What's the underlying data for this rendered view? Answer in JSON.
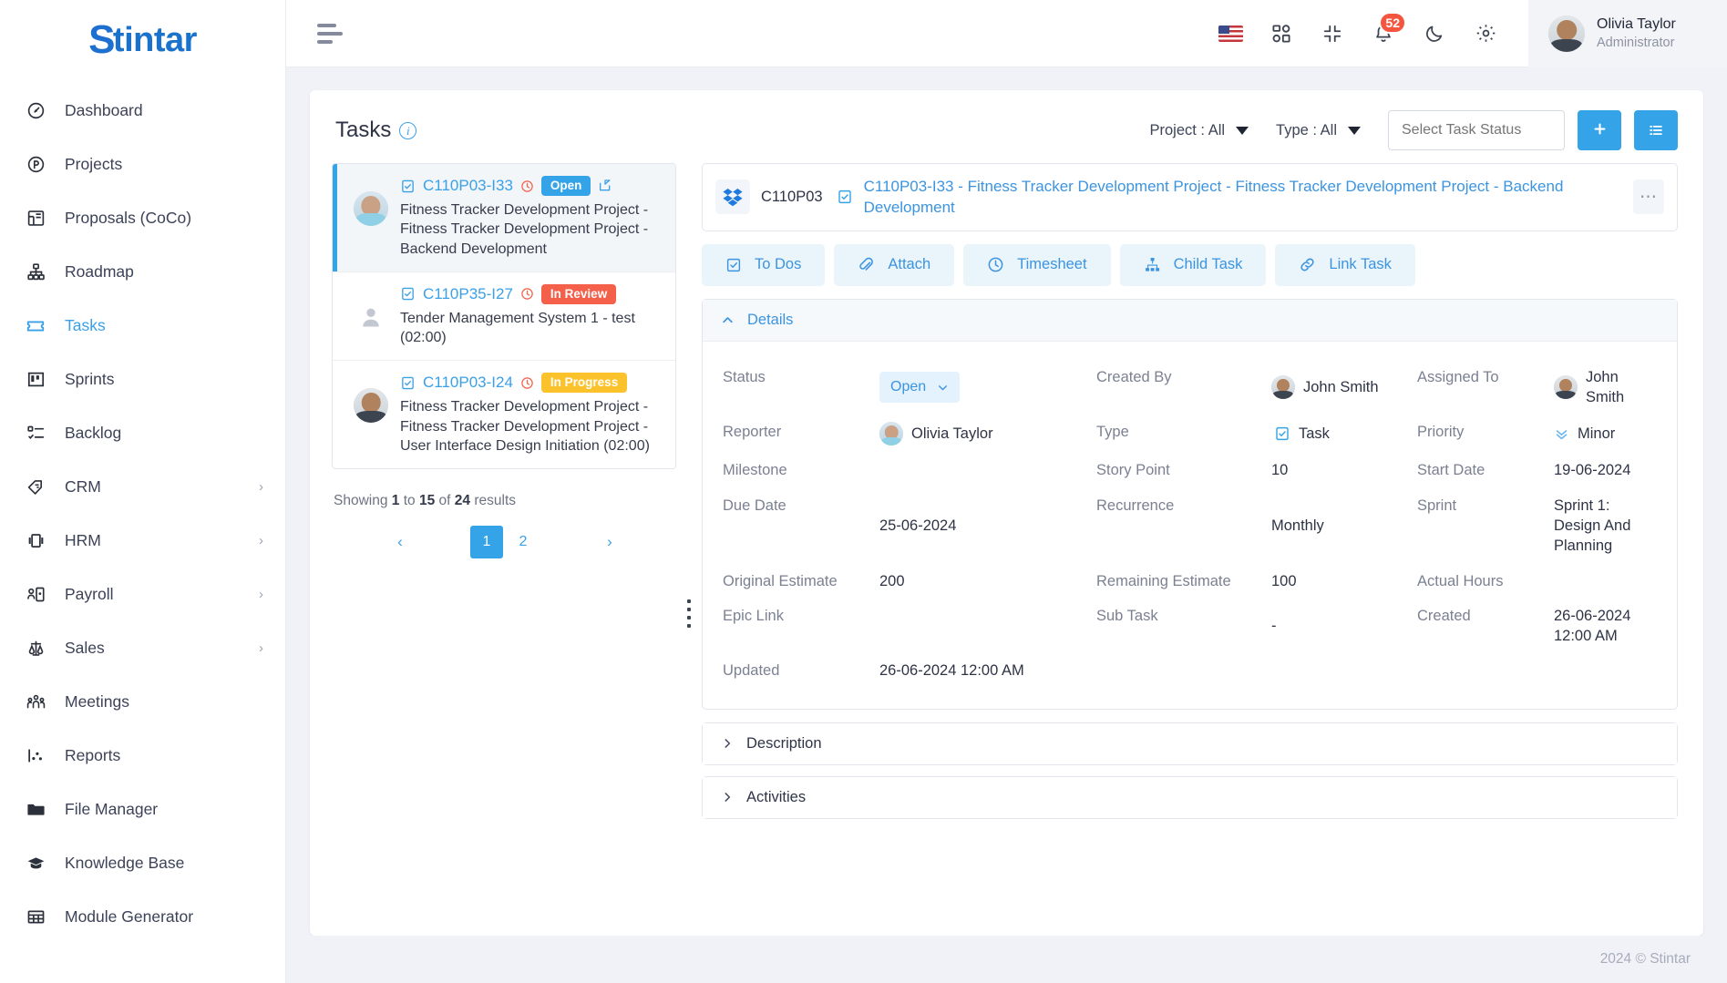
{
  "brand": {
    "logo_first": "S",
    "logo_rest": "tintar",
    "accent": "#34a3e8"
  },
  "sidebar": {
    "items": [
      {
        "label": "Dashboard",
        "icon": "gauge-icon",
        "active": false,
        "expandable": false
      },
      {
        "label": "Projects",
        "icon": "circle-p-icon",
        "active": false,
        "expandable": false
      },
      {
        "label": "Proposals (CoCo)",
        "icon": "layout-icon",
        "active": false,
        "expandable": false
      },
      {
        "label": "Roadmap",
        "icon": "hierarchy-icon",
        "active": false,
        "expandable": false
      },
      {
        "label": "Tasks",
        "icon": "ticket-icon",
        "active": true,
        "expandable": false
      },
      {
        "label": "Sprints",
        "icon": "board-icon",
        "active": false,
        "expandable": false
      },
      {
        "label": "Backlog",
        "icon": "checklist-icon",
        "active": false,
        "expandable": false
      },
      {
        "label": "CRM",
        "icon": "handshake-icon",
        "active": false,
        "expandable": true
      },
      {
        "label": "HRM",
        "icon": "badge-icon",
        "active": false,
        "expandable": true
      },
      {
        "label": "Payroll",
        "icon": "person-card-icon",
        "active": false,
        "expandable": true
      },
      {
        "label": "Sales",
        "icon": "scales-icon",
        "active": false,
        "expandable": true
      },
      {
        "label": "Meetings",
        "icon": "people-icon",
        "active": false,
        "expandable": false
      },
      {
        "label": "Reports",
        "icon": "scatter-chart-icon",
        "active": false,
        "expandable": false
      },
      {
        "label": "File Manager",
        "icon": "folder-icon",
        "active": false,
        "expandable": false
      },
      {
        "label": "Knowledge Base",
        "icon": "graduation-cap-icon",
        "active": false,
        "expandable": false
      },
      {
        "label": "Module Generator",
        "icon": "grid-table-icon",
        "active": false,
        "expandable": false
      }
    ]
  },
  "topbar": {
    "menu_icon": "hamburger-icon",
    "language_flag": "us-flag-icon",
    "apps_icon": "apps-grid-icon",
    "fullscreen_icon": "compress-icon",
    "notifications_icon": "bell-icon",
    "notifications_count": "52",
    "theme_icon": "moon-icon",
    "settings_icon": "gear-icon",
    "user": {
      "name": "Olivia Taylor",
      "role": "Administrator"
    }
  },
  "page": {
    "title": "Tasks",
    "info_icon": "info-icon",
    "filters": [
      {
        "label": "Project : All"
      },
      {
        "label": "Type : All"
      }
    ],
    "status_search_placeholder": "Select Task Status",
    "add_button_label": "+",
    "list_button_icon": "list-icon"
  },
  "task_list": {
    "items": [
      {
        "key": "C110P03-I33",
        "status_label": "Open",
        "status_kind": "open",
        "has_clock": true,
        "has_external": true,
        "avatar": "male-photo",
        "description": "Fitness Tracker Development Project - Fitness Tracker Development Project - Backend Development",
        "selected": true
      },
      {
        "key": "C110P35-I27",
        "status_label": "In Review",
        "status_kind": "review",
        "has_clock": true,
        "has_external": false,
        "avatar": "placeholder",
        "description": "Tender Management System 1 - test (02:00)",
        "selected": false
      },
      {
        "key": "C110P03-I24",
        "status_label": "In Progress",
        "status_kind": "progress",
        "has_clock": true,
        "has_external": false,
        "avatar": "male-photo-dark",
        "description": "Fitness Tracker Development Project - Fitness Tracker Development Project - User Interface Design Initiation (02:00)",
        "selected": false
      }
    ],
    "showing_prefix": "Showing",
    "showing_from": "1",
    "showing_mid": "to",
    "showing_to": "15",
    "showing_of": "of",
    "showing_total": "24",
    "showing_suffix": "results",
    "pagination": {
      "prev": "‹",
      "pages": [
        "1",
        "2"
      ],
      "active_page": "1",
      "next": "›"
    }
  },
  "detail": {
    "project_key": "C110P03",
    "project_icon": "dropbox-icon",
    "type_icon": "task-clipboard-icon",
    "title": "C110P03-I33 - Fitness Tracker Development Project - Fitness Tracker Development Project - Backend Development",
    "more_button": "⋯",
    "actions": [
      {
        "label": "To Dos",
        "icon": "checkbox-icon"
      },
      {
        "label": "Attach",
        "icon": "paperclip-icon"
      },
      {
        "label": "Timesheet",
        "icon": "clock-icon"
      },
      {
        "label": "Child Task",
        "icon": "hierarchy-icon"
      },
      {
        "label": "Link Task",
        "icon": "link-icon"
      }
    ],
    "details_section": {
      "title": "Details",
      "expanded": true
    },
    "fields": {
      "status_label": "Status",
      "status_value": "Open",
      "created_by_label": "Created By",
      "created_by_value": "John Smith",
      "assigned_to_label": "Assigned To",
      "assigned_to_value": "John Smith",
      "reporter_label": "Reporter",
      "reporter_value": "Olivia Taylor",
      "type_label": "Type",
      "type_value": "Task",
      "priority_label": "Priority",
      "priority_value": "Minor",
      "milestone_label": "Milestone",
      "milestone_value": "",
      "story_point_label": "Story Point",
      "story_point_value": "10",
      "start_date_label": "Start Date",
      "start_date_value": "19-06-2024",
      "due_date_label": "Due Date",
      "due_date_value": "25-06-2024",
      "recurrence_label": "Recurrence",
      "recurrence_value": "Monthly",
      "sprint_label": "Sprint",
      "sprint_value": "Sprint 1: Design And Planning",
      "original_estimate_label": "Original Estimate",
      "original_estimate_value": "200",
      "remaining_estimate_label": "Remaining Estimate",
      "remaining_estimate_value": "100",
      "actual_hours_label": "Actual Hours",
      "actual_hours_value": "",
      "epic_link_label": "Epic Link",
      "epic_link_value": "",
      "sub_task_label": "Sub Task",
      "sub_task_value": "-",
      "created_label": "Created",
      "created_value": "26-06-2024 12:00 AM",
      "updated_label": "Updated",
      "updated_value": "26-06-2024 12:00 AM"
    },
    "description_section": {
      "title": "Description",
      "expanded": false
    },
    "activities_section": {
      "title": "Activities",
      "expanded": false
    }
  },
  "footer": {
    "copyright": "2024 © Stintar"
  }
}
